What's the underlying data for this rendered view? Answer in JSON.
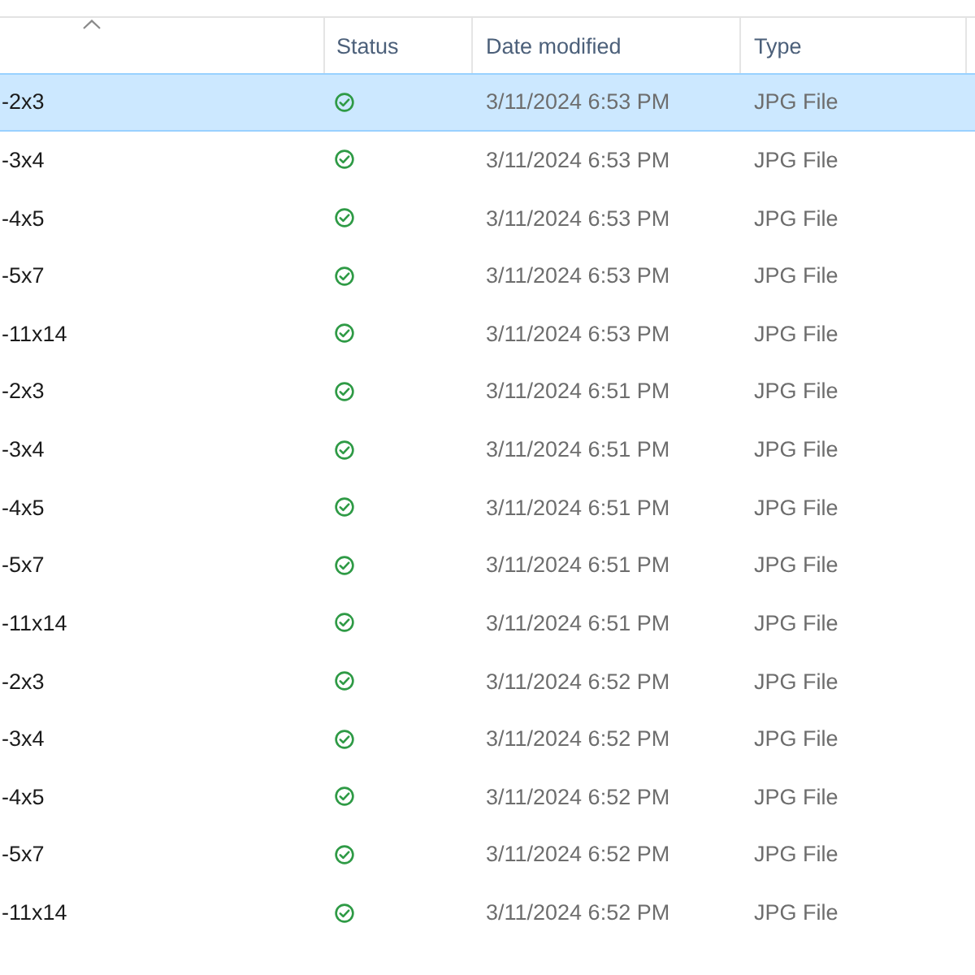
{
  "table": {
    "columns": [
      {
        "sorted": true
      },
      {
        "label": "Status",
        "sorted": false
      },
      {
        "label": "Date modified",
        "sorted": false
      },
      {
        "label": "Type",
        "sorted": false
      }
    ],
    "rows": [
      {
        "column_1": "-2x3",
        "date_modified": "3/11/2024 6:53 PM",
        "type": "JPG File",
        "selected": true
      },
      {
        "column_1": "-3x4",
        "date_modified": "3/11/2024 6:53 PM",
        "type": "JPG File",
        "selected": false
      },
      {
        "column_1": "-4x5",
        "date_modified": "3/11/2024 6:53 PM",
        "type": "JPG File",
        "selected": false
      },
      {
        "column_1": "-5x7",
        "date_modified": "3/11/2024 6:53 PM",
        "type": "JPG File",
        "selected": false
      },
      {
        "column_1": "-11x14",
        "date_modified": "3/11/2024 6:53 PM",
        "type": "JPG File",
        "selected": false
      },
      {
        "column_1": "-2x3",
        "date_modified": "3/11/2024 6:51 PM",
        "type": "JPG File",
        "selected": false
      },
      {
        "column_1": "-3x4",
        "date_modified": "3/11/2024 6:51 PM",
        "type": "JPG File",
        "selected": false
      },
      {
        "column_1": "-4x5",
        "date_modified": "3/11/2024 6:51 PM",
        "type": "JPG File",
        "selected": false
      },
      {
        "column_1": "-5x7",
        "date_modified": "3/11/2024 6:51 PM",
        "type": "JPG File",
        "selected": false
      },
      {
        "column_1": "-11x14",
        "date_modified": "3/11/2024 6:51 PM",
        "type": "JPG File",
        "selected": false
      },
      {
        "column_1": "-2x3",
        "date_modified": "3/11/2024 6:52 PM",
        "type": "JPG File",
        "selected": false
      },
      {
        "column_1": "-3x4",
        "date_modified": "3/11/2024 6:52 PM",
        "type": "JPG File",
        "selected": false
      },
      {
        "column_1": "-4x5",
        "date_modified": "3/11/2024 6:52 PM",
        "type": "JPG File",
        "selected": false
      },
      {
        "column_1": "-5x7",
        "date_modified": "3/11/2024 6:52 PM",
        "type": "JPG File",
        "selected": false
      },
      {
        "column_1": "-11x14",
        "date_modified": "3/11/2024 6:52 PM",
        "type": "JPG File",
        "selected": false
      }
    ]
  }
}
